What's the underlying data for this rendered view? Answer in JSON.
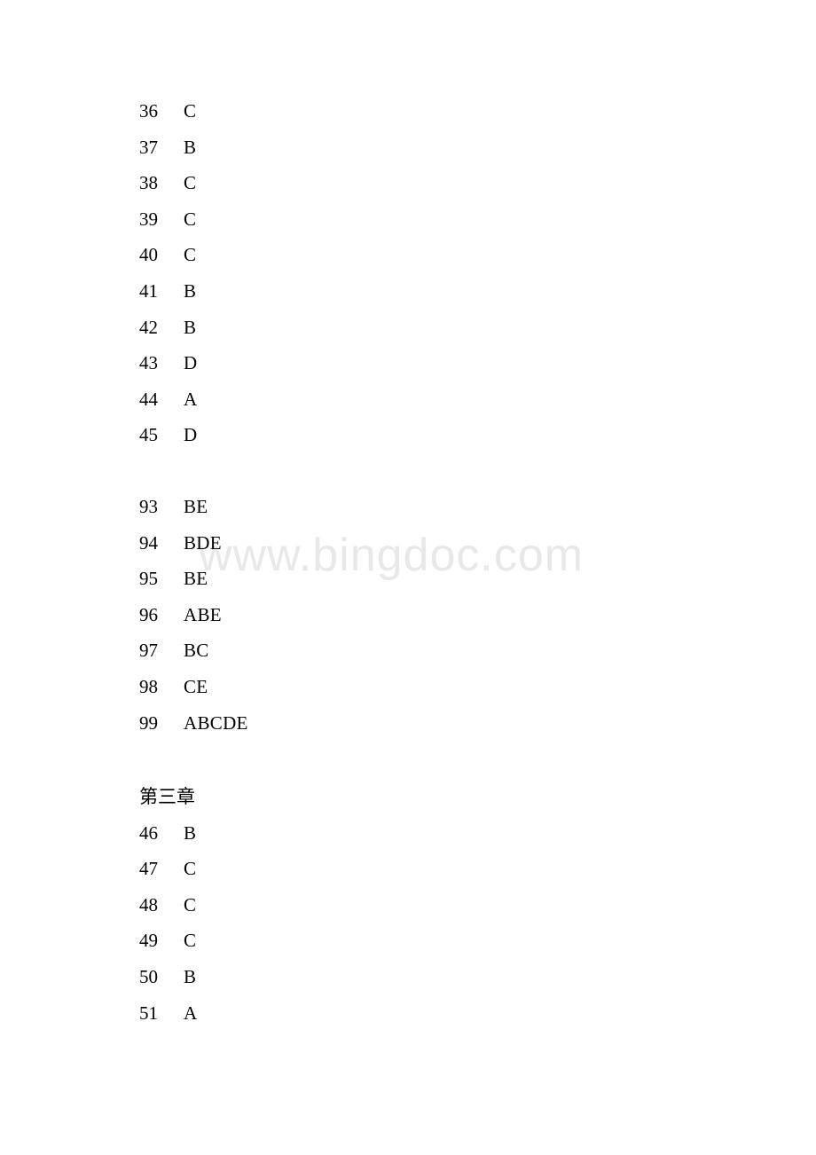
{
  "document": {
    "page_background": "#ffffff",
    "text_color": "#000000",
    "watermark": {
      "text": "www.bingdoc.com",
      "color": "#e8e8e8"
    },
    "blocks": [
      {
        "id": "answers-36-45",
        "heading": null,
        "rows": [
          {
            "number": "36",
            "answer": "C"
          },
          {
            "number": "37",
            "answer": "B"
          },
          {
            "number": "38",
            "answer": "C"
          },
          {
            "number": "39",
            "answer": "C"
          },
          {
            "number": "40",
            "answer": "C"
          },
          {
            "number": "41",
            "answer": "B"
          },
          {
            "number": "42",
            "answer": "B"
          },
          {
            "number": "43",
            "answer": "D"
          },
          {
            "number": "44",
            "answer": "A"
          },
          {
            "number": "45",
            "answer": "D"
          }
        ]
      },
      {
        "id": "answers-93-99",
        "heading": null,
        "rows": [
          {
            "number": "93",
            "answer": "BE"
          },
          {
            "number": "94",
            "answer": "BDE"
          },
          {
            "number": "95",
            "answer": "BE"
          },
          {
            "number": "96",
            "answer": "ABE"
          },
          {
            "number": "97",
            "answer": "BC"
          },
          {
            "number": "98",
            "answer": "CE"
          },
          {
            "number": "99",
            "answer": "ABCDE"
          }
        ]
      },
      {
        "id": "chapter-three",
        "heading": "第三章",
        "rows": [
          {
            "number": "46",
            "answer": "B"
          },
          {
            "number": "47",
            "answer": "C"
          },
          {
            "number": "48",
            "answer": "C"
          },
          {
            "number": "49",
            "answer": "C"
          },
          {
            "number": "50",
            "answer": "B"
          },
          {
            "number": "51",
            "answer": "A"
          }
        ]
      }
    ]
  }
}
